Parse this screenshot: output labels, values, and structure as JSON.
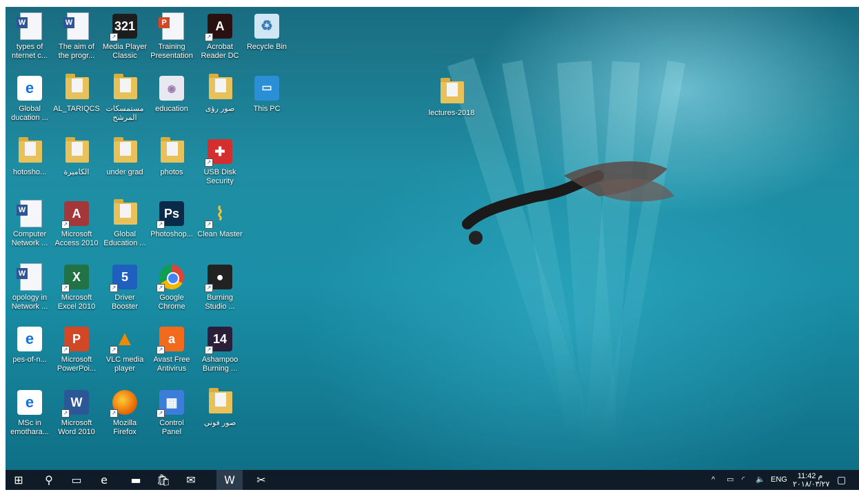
{
  "desktop_icons": [
    {
      "label": "types of\nnternet c...",
      "icon": "word-document-icon",
      "kind": "doc"
    },
    {
      "label": "The aim of\nthe progr...",
      "icon": "word-document-icon",
      "kind": "doc"
    },
    {
      "label": "Media Player\nClassic",
      "icon": "media-player-classic-icon",
      "kind": "app",
      "color": "#1d1d1d",
      "text": "321"
    },
    {
      "label": "Training\nPresentation",
      "icon": "powerpoint-document-icon",
      "kind": "ppt"
    },
    {
      "label": "Acrobat\nReader DC",
      "icon": "acrobat-reader-icon",
      "kind": "app",
      "color": "#2a1010",
      "text": "A"
    },
    {
      "label": "Recycle Bin",
      "icon": "recycle-bin-icon",
      "kind": "bin"
    },
    {
      "label": "Global\nducation ...",
      "icon": "edge-pdf-icon",
      "kind": "edge"
    },
    {
      "label": "AL_TARIQCS",
      "icon": "user-folder-icon",
      "kind": "folder"
    },
    {
      "label": "مستمسكات\nالمرشح",
      "icon": "folder-icon",
      "kind": "folder"
    },
    {
      "label": "education",
      "icon": "image-file-icon",
      "kind": "image"
    },
    {
      "label": "صور رؤى",
      "icon": "folder-icon",
      "kind": "folder"
    },
    {
      "label": "This PC",
      "icon": "this-pc-icon",
      "kind": "pc"
    },
    {
      "label": "hotosho...",
      "icon": "folder-icon",
      "kind": "folder"
    },
    {
      "label": "الكاميرة",
      "icon": "folder-icon",
      "kind": "folder"
    },
    {
      "label": "under grad",
      "icon": "folder-icon",
      "kind": "folder"
    },
    {
      "label": "photos",
      "icon": "folder-icon",
      "kind": "folder"
    },
    {
      "label": "USB Disk\nSecurity",
      "icon": "usb-disk-security-shield-icon",
      "kind": "shield"
    },
    {
      "label": "Computer\nNetwork ...",
      "icon": "word-document-icon",
      "kind": "doc"
    },
    {
      "label": "Microsoft\nAccess 2010",
      "icon": "access-icon",
      "kind": "app",
      "color": "#a4373a",
      "text": "A"
    },
    {
      "label": "Global\nEducation ...",
      "icon": "folder-icon",
      "kind": "folder"
    },
    {
      "label": "Photoshop...",
      "icon": "photoshop-icon",
      "kind": "app",
      "color": "#0a2a4a",
      "text": "Ps"
    },
    {
      "label": "Clean Master",
      "icon": "clean-master-broom-icon",
      "kind": "broom"
    },
    {
      "label": "opology in\nNetwork ...",
      "icon": "word-document-icon",
      "kind": "doc"
    },
    {
      "label": "Microsoft\nExcel 2010",
      "icon": "excel-icon",
      "kind": "app",
      "color": "#217346",
      "text": "X"
    },
    {
      "label": "Driver\nBooster",
      "icon": "driver-booster-icon",
      "kind": "app",
      "color": "#1e5fbf",
      "text": "5"
    },
    {
      "label": "Google\nChrome",
      "icon": "chrome-icon",
      "kind": "chrome"
    },
    {
      "label": "Burning\nStudio ...",
      "icon": "burning-studio-disc-icon",
      "kind": "app",
      "color": "#222222",
      "text": "●"
    },
    {
      "label": "pes-of-n...",
      "icon": "edge-pdf-icon",
      "kind": "edge"
    },
    {
      "label": "Microsoft\nPowerPoi...",
      "icon": "powerpoint-icon",
      "kind": "app",
      "color": "#d24726",
      "text": "P"
    },
    {
      "label": "VLC media\nplayer",
      "icon": "vlc-cone-icon",
      "kind": "vlc"
    },
    {
      "label": "Avast Free\nAntivirus",
      "icon": "avast-icon",
      "kind": "app",
      "color": "#f26b1d",
      "text": "a"
    },
    {
      "label": "Ashampoo\nBurning ...",
      "icon": "ashampoo-disc-icon",
      "kind": "app",
      "color": "#2a1e3a",
      "text": "14"
    },
    {
      "label": "MSc in\nemothara...",
      "icon": "edge-pdf-icon",
      "kind": "edge"
    },
    {
      "label": "Microsoft\nWord 2010",
      "icon": "word-icon",
      "kind": "app",
      "color": "#2b5797",
      "text": "W"
    },
    {
      "label": "Mozilla\nFirefox",
      "icon": "firefox-icon",
      "kind": "firefox"
    },
    {
      "label": "Control\nPanel",
      "icon": "control-panel-icon",
      "kind": "app",
      "color": "#3b7dd8",
      "text": "▦"
    },
    {
      "label": "صور فوني",
      "icon": "folder-icon",
      "kind": "folder"
    }
  ],
  "extra_icon": {
    "label": "lectures-2018",
    "icon": "folder-icon"
  },
  "taskbar": {
    "items": [
      {
        "name": "start-button",
        "glyph": "⊞",
        "icon": "windows-logo-icon"
      },
      {
        "name": "search-button",
        "glyph": "⚲",
        "icon": "search-icon"
      },
      {
        "name": "task-view-button",
        "glyph": "▭",
        "icon": "task-view-icon"
      },
      {
        "name": "edge-taskbar-button",
        "glyph": "e",
        "icon": "edge-icon"
      },
      {
        "name": "file-explorer-taskbar-button",
        "glyph": "▬",
        "icon": "file-explorer-icon"
      },
      {
        "name": "store-taskbar-button",
        "glyph": "🛍",
        "icon": "store-icon"
      },
      {
        "name": "mail-taskbar-button",
        "glyph": "✉",
        "icon": "mail-icon"
      },
      {
        "name": "word-taskbar-button",
        "glyph": "W",
        "icon": "word-icon"
      },
      {
        "name": "snipping-tool-taskbar-button",
        "glyph": "✂",
        "icon": "snipping-tool-icon"
      }
    ],
    "tray": {
      "chevron": "^",
      "language": "ENG",
      "time": "11:42 م",
      "date": "٢٠١٨/٠٣/٢٧",
      "notification_glyph": "▢"
    }
  }
}
